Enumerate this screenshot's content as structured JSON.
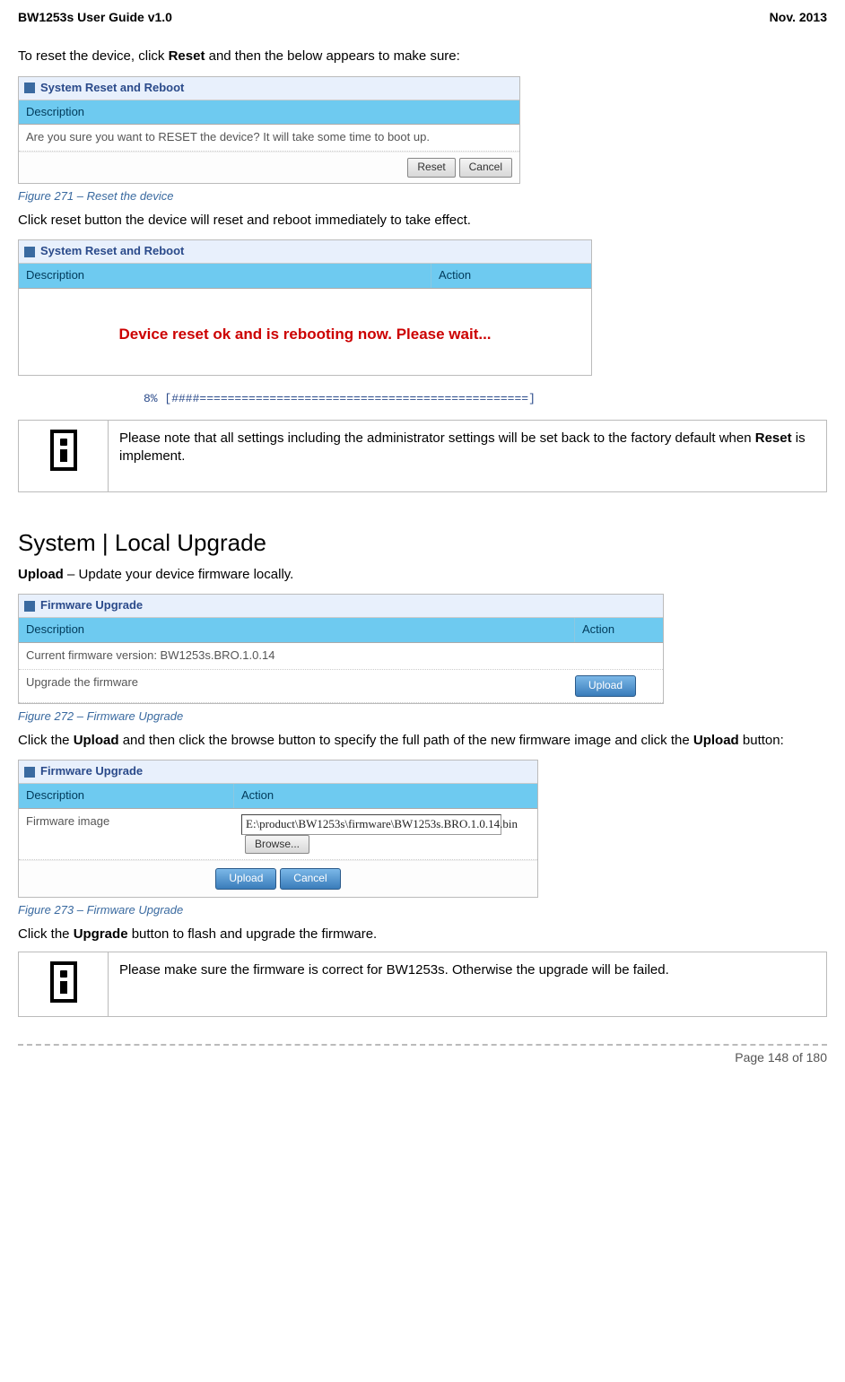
{
  "header": {
    "left": "BW1253s User Guide v1.0",
    "right": "Nov.  2013"
  },
  "intro1": {
    "pre": "To reset the device, click ",
    "bold": "Reset",
    "post": " and then the below appears to make sure:"
  },
  "shot1": {
    "title": "System Reset and Reboot",
    "col": "Description",
    "msg": "Are you sure you want to RESET the device? It will take some time to boot up.",
    "btn_reset": "Reset",
    "btn_cancel": "Cancel"
  },
  "cap1": "Figure 271 – Reset the device",
  "line1": "Click reset button the device will reset and reboot immediately to take effect.",
  "shot2": {
    "title": "System Reset and Reboot",
    "col1": "Description",
    "col2": "Action",
    "reboot": "Device reset ok and is rebooting now. Please wait...",
    "progress": "8% [####===============================================]"
  },
  "note1": {
    "pre": "Please note that all settings including the administrator settings will be set back to the factory default when ",
    "bold": "Reset",
    "post": " is implement."
  },
  "heading": "System | Local Upgrade",
  "uploadline": {
    "bold": "Upload",
    "post": " – Update your device firmware locally."
  },
  "shot3": {
    "title": "Firmware Upgrade",
    "col1": "Description",
    "col2": "Action",
    "row1": "Current firmware version: BW1253s.BRO.1.0.14",
    "row2": "Upgrade the firmware",
    "btn_upload": "Upload"
  },
  "cap2": "Figure 272 – Firmware Upgrade",
  "para3": {
    "pre": "Click the ",
    "b1": "Upload",
    "mid": " and then click the browse button to specify the full path of the new firmware image and click the ",
    "b2": "Upload",
    "post": " button:"
  },
  "shot4": {
    "title": "Firmware Upgrade",
    "col1": "Description",
    "col2": "Action",
    "row_label": "Firmware image",
    "input_value": "E:\\product\\BW1253s\\firmware\\BW1253s.BRO.1.0.14.bin",
    "btn_browse": "Browse...",
    "btn_upload": "Upload",
    "btn_cancel": "Cancel"
  },
  "cap3": "Figure 273 – Firmware Upgrade",
  "para4": {
    "pre": "Click the ",
    "bold": "Upgrade",
    "post": " button to flash and upgrade the firmware."
  },
  "note2": "Please make sure the firmware is correct for BW1253s. Otherwise the upgrade will be failed.",
  "footer": "Page 148 of 180"
}
